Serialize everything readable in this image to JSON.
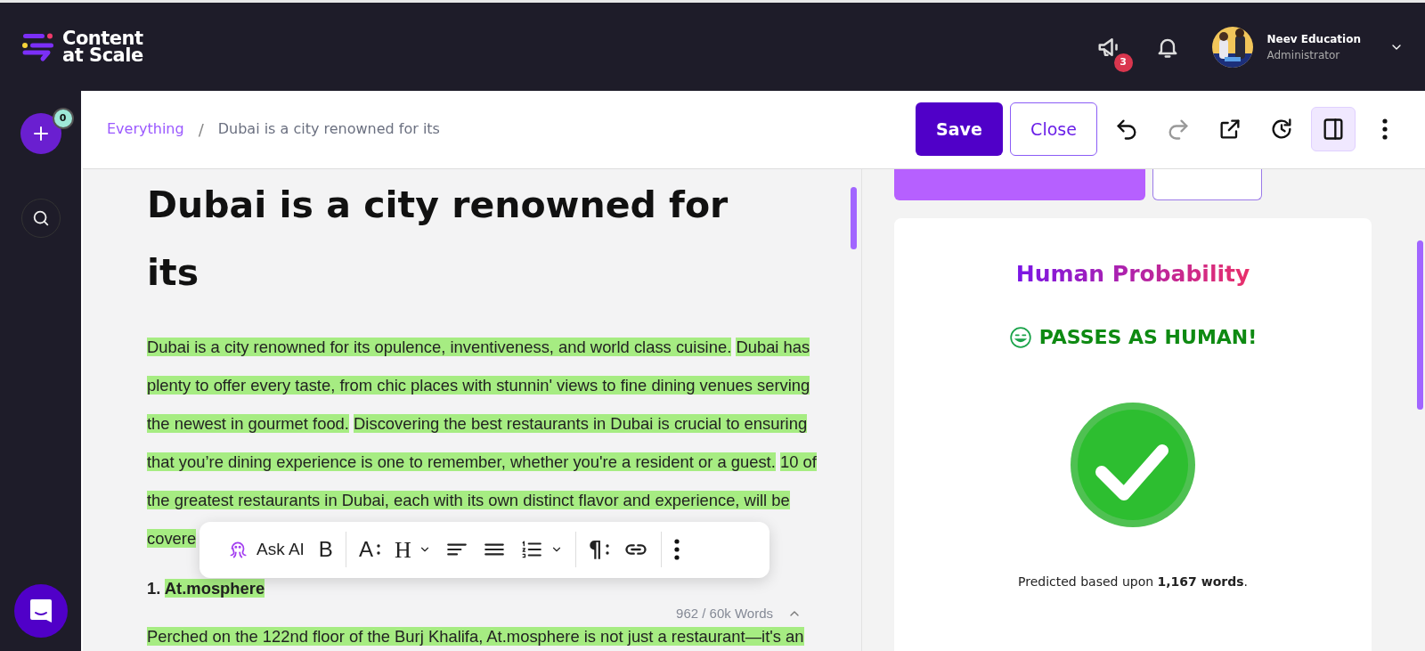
{
  "app": {
    "logo_line1": "Content",
    "logo_line2": "at Scale"
  },
  "topbar": {
    "announcements_badge": "3",
    "user": {
      "name": "Neev Education",
      "role": "Administrator"
    }
  },
  "sidebar": {
    "new_badge": "0"
  },
  "breadcrumb": {
    "separator": "/",
    "items": [
      {
        "kind": "link",
        "label": "Everything"
      },
      {
        "kind": "current",
        "label": "Dubai is a city renowned for its"
      }
    ]
  },
  "actions": [
    {
      "kind": "primary",
      "label": "Save"
    },
    {
      "kind": "outline",
      "label": "Close"
    },
    {
      "kind": "undo",
      "disabled": false
    },
    {
      "kind": "redo",
      "disabled": true
    },
    {
      "kind": "external",
      "disabled": false
    },
    {
      "kind": "history",
      "disabled": false
    },
    {
      "kind": "panel",
      "selected": true
    },
    {
      "kind": "more"
    }
  ],
  "editor": {
    "title": "Dubai is a city renowned for its",
    "sentences": [
      {
        "text": "Dubai is a city renowned for its opulence, inventiveness, and world class cuisine.",
        "highlighted": true
      },
      {
        "text": "Dubai has plenty to offer every taste, from chic places with stunnin' views to fine dining venues serving the newest in gourmet food.",
        "highlighted": true
      },
      {
        "text": "Discovering the best restaurants in Dubai is crucial to ensuring that you’re dining experience is one to remember, whether you're a resident or a guest.",
        "highlighted": true
      },
      {
        "text": "10 of the greatest restaurants in Dubai, each with its own distinct flavor and experience, will be covere",
        "highlighted": true
      }
    ],
    "list_item": {
      "number": "1.",
      "text": "At.mosphere",
      "highlighted": true
    },
    "word_count": "962 / 60k Words",
    "next_paragraph": {
      "text": "Perched on the 122nd floor of the Burj Khalifa, At.mosphere is not just a restaurant—it's an",
      "highlighted": true
    }
  },
  "toolbar": [
    {
      "kind": "ai",
      "label": "Ask AI"
    },
    {
      "kind": "bold",
      "label": "B"
    },
    {
      "kind": "divider"
    },
    {
      "kind": "font-size",
      "label": "A"
    },
    {
      "kind": "heading",
      "label": "H"
    },
    {
      "kind": "align-left"
    },
    {
      "kind": "justify"
    },
    {
      "kind": "ordered-list"
    },
    {
      "kind": "divider"
    },
    {
      "kind": "paragraph",
      "label": "¶"
    },
    {
      "kind": "link"
    },
    {
      "kind": "divider"
    },
    {
      "kind": "more"
    }
  ],
  "panel": {
    "title": "Human Probability",
    "verdict": "PASSES AS HUMAN!",
    "note": "Predicted based upon **1,167 words**."
  }
}
